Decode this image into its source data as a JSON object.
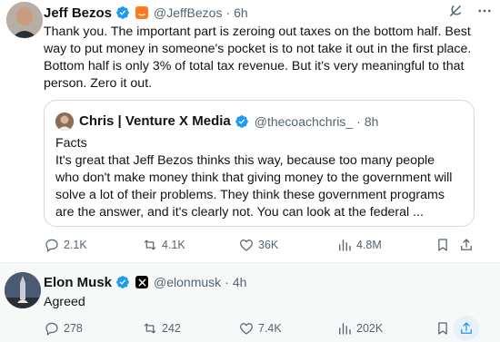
{
  "tweets": [
    {
      "author": {
        "name": "Jeff Bezos",
        "handle": "@JeffBezos",
        "time": "6h",
        "affiliation_badge": "amazon-badge"
      },
      "text": "Thank you. The important part is zeroing out taxes on the bottom half. Best way to put money in someone's pocket is to not take it out in the first place. Bottom half is only 3% of total tax revenue. But it's very meaningful to that person. Zero it out.",
      "quote": {
        "author_name": "Chris | Venture X Media",
        "handle": "@thecoachchris_",
        "time": "8h",
        "text": "Facts\nIt's great that Jeff Bezos thinks this way, because too many people who don't make money think that giving money to the government will solve a lot of their problems. They think these government programs are the answer, and it's clearly not. You can look at the federal ..."
      },
      "stats": {
        "replies": "2.1K",
        "retweets": "4.1K",
        "likes": "36K",
        "views": "4.8M"
      }
    },
    {
      "author": {
        "name": "Elon Musk",
        "handle": "@elonmusk",
        "time": "4h",
        "affiliation_badge": "x-badge"
      },
      "text": "Agreed",
      "stats": {
        "replies": "278",
        "retweets": "242",
        "likes": "7.4K",
        "views": "202K"
      }
    }
  ],
  "separator": "·",
  "icons": {
    "verified": "verified-badge-icon",
    "grok": "grok-icon",
    "more": "more-icon",
    "reply": "reply-icon",
    "retweet": "retweet-icon",
    "like": "like-icon",
    "views": "views-icon",
    "bookmark": "bookmark-icon",
    "share": "share-icon"
  },
  "colors": {
    "verified_blue": "#1d9bf0",
    "text_primary": "#0f1419",
    "text_secondary": "#536471",
    "amazon_orange": "#ff7a1a"
  }
}
